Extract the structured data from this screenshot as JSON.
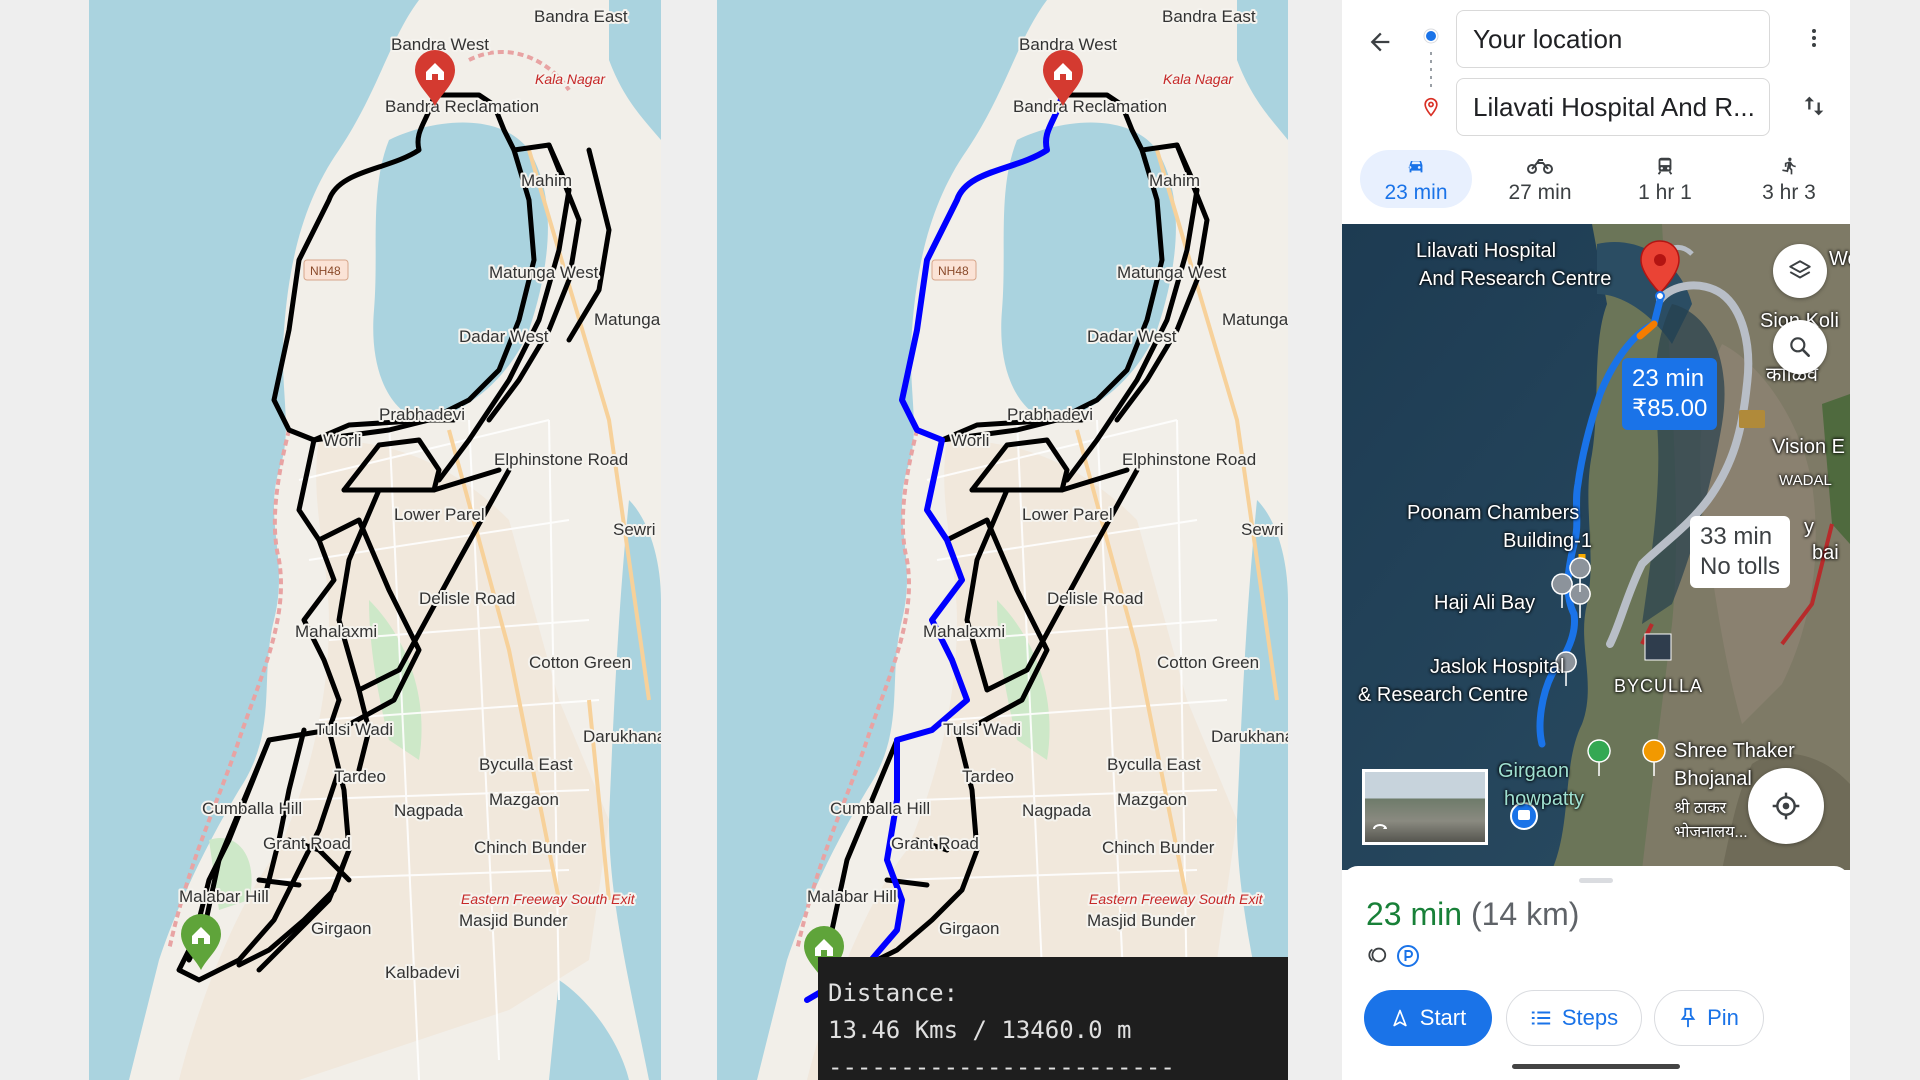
{
  "left_map": {
    "labels": {
      "bandra_east": "Bandra East",
      "bandra_west": "Bandra West",
      "kala_nagar": "Kala Nagar",
      "bandra_reclamation": "Bandra Reclamation",
      "mahim": "Mahim",
      "matunga_west": "Matunga West",
      "matunga_east": "Matunga Eas",
      "dadar_west": "Dadar West",
      "prabhadevi": "Prabhadevi",
      "worli": "Worli",
      "elphinstone_road": "Elphinstone Road",
      "lower_parel": "Lower Parel",
      "sewri": "Sewri",
      "delisle_road": "Delisle Road",
      "mahalaxmi": "Mahalaxmi",
      "cotton_green": "Cotton Green",
      "darukhana": "Darukhana",
      "tulsi_wadi": "Tulsi Wadi",
      "byculla_east": "Byculla East",
      "tardeo": "Tardeo",
      "mazgaon": "Mazgaon",
      "cumballa_hill": "Cumballa Hill",
      "nagpada": "Nagpada",
      "grant_road": "Grant Road",
      "chinch_bunder": "Chinch Bunder",
      "malabar_hill": "Malabar Hill",
      "eastern_freeway": "Eastern Freeway South Exit",
      "masjid_bunder": "Masjid Bunder",
      "girgaon": "Girgaon",
      "kalbadevi": "Kalbadevi",
      "nh48": "NH48"
    }
  },
  "right_map": {
    "terminal": {
      "line1": "Distance:",
      "line2": "13.46 Kms / 13460.0 m",
      "line3": "------------------------"
    }
  },
  "gmaps": {
    "origin": "Your location",
    "destination": "Lilavati Hospital And R...",
    "modes": [
      {
        "icon": "car-icon",
        "label": "23 min",
        "active": true
      },
      {
        "icon": "motorbike-icon",
        "label": "27 min",
        "active": false
      },
      {
        "icon": "transit-icon",
        "label": "1 hr 1",
        "active": false
      },
      {
        "icon": "walk-icon",
        "label": "3 hr 3",
        "active": false
      }
    ],
    "map": {
      "dest_label_1": "Lilavati Hospital",
      "dest_label_2": "And Research Centre",
      "route_time": "23 min",
      "route_price": "₹85.00",
      "alt_time": "33 min",
      "alt_note": "No tolls",
      "poonam_1": "Poonam Chambers",
      "poonam_2": "Building-1",
      "haji_ali": "Haji Ali Bay",
      "jaslok_1": "Jaslok Hospital",
      "jaslok_2": "& Research Centre",
      "byculla": "BYCULLA",
      "girgaon": "Girgaon",
      "chowpatty": "howpatty",
      "shree_1": "Shree Thaker",
      "shree_2": "Bhojanal",
      "shree_3": "श्री ठाकर",
      "shree_4": "भोजनालय...",
      "vision": "Vision E",
      "wadala": "WADAL",
      "sion_koli": "Sion Koli",
      "kalivad": "काळिव",
      "wo": "Wo",
      "bai": "bai",
      "y": "y"
    },
    "summary": {
      "time": "23 min",
      "distance": "(14 km)"
    },
    "actions": {
      "start": "Start",
      "steps": "Steps",
      "pin": "Pin"
    }
  }
}
